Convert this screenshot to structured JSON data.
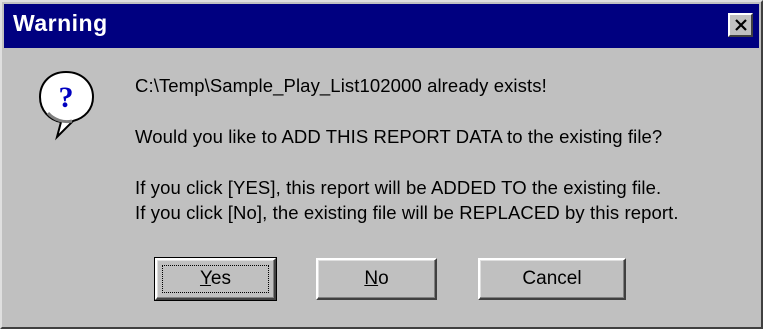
{
  "window": {
    "title": "Warning",
    "close_glyph": "✕"
  },
  "icon": {
    "name": "question-icon",
    "glyph": "?"
  },
  "message": {
    "line1": "C:\\Temp\\Sample_Play_List102000 already exists!",
    "line2": "Would you like to ADD THIS REPORT DATA to the existing file?",
    "line3": "If you click [YES], this report will be ADDED TO the existing file.",
    "line4": "If you click [No], the existing file will be REPLACED by this report."
  },
  "buttons": {
    "yes": {
      "mnemonic": "Y",
      "rest": "es"
    },
    "no": {
      "mnemonic": "N",
      "rest": "o"
    },
    "cancel": "Cancel"
  },
  "colors": {
    "titlebar": "#000080",
    "face": "#c0c0c0"
  }
}
